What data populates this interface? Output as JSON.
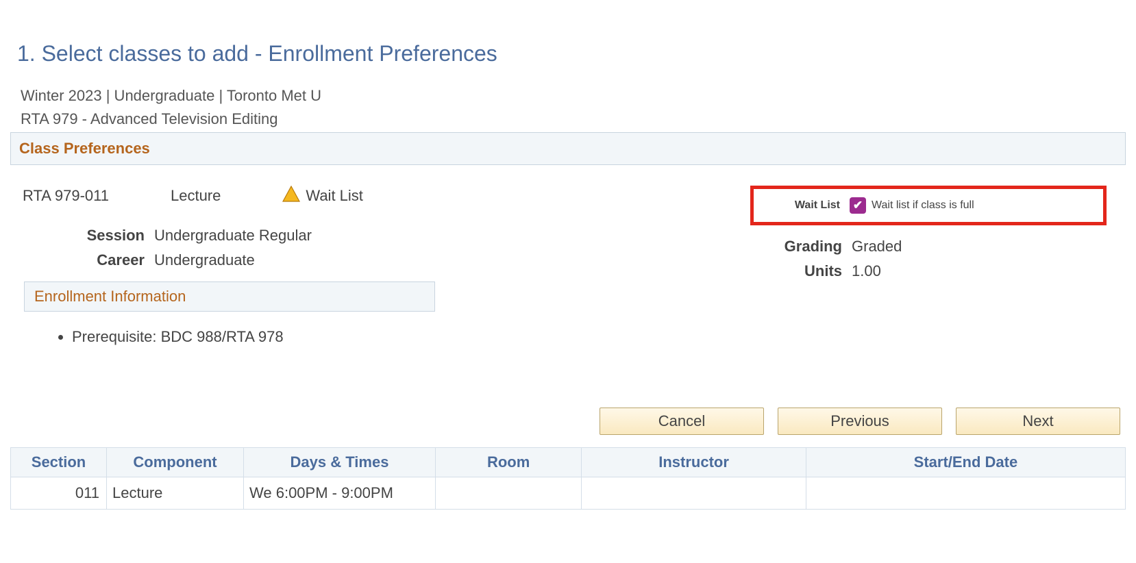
{
  "page_title": "1.  Select classes to add - Enrollment Preferences",
  "context_line": "Winter 2023 | Undergraduate | Toronto Met U",
  "course_line": "RTA  979 - Advanced Television Editing",
  "class_prefs_header": "Class Preferences",
  "class_code": "RTA  979-011",
  "component": "Lecture",
  "status_text": "Wait List",
  "left_fields": {
    "session_label": "Session",
    "session_value": "Undergraduate Regular",
    "career_label": "Career",
    "career_value": "Undergraduate"
  },
  "right_fields": {
    "waitlist_label": "Wait List",
    "waitlist_checkbox_label": "Wait list if class is full",
    "grading_label": "Grading",
    "grading_value": "Graded",
    "units_label": "Units",
    "units_value": "1.00"
  },
  "enroll_info_header": "Enrollment Information",
  "prerequisite_text": "Prerequisite: BDC 988/RTA 978",
  "buttons": {
    "cancel": "Cancel",
    "previous": "Previous",
    "next": "Next"
  },
  "table": {
    "headers": {
      "section": "Section",
      "component": "Component",
      "days_times": "Days & Times",
      "room": "Room",
      "instructor": "Instructor",
      "start_end": "Start/End Date"
    },
    "row": {
      "section": "011",
      "component": "Lecture",
      "days_times": "We 6:00PM - 9:00PM",
      "room": "",
      "instructor": "",
      "start_end": ""
    }
  }
}
